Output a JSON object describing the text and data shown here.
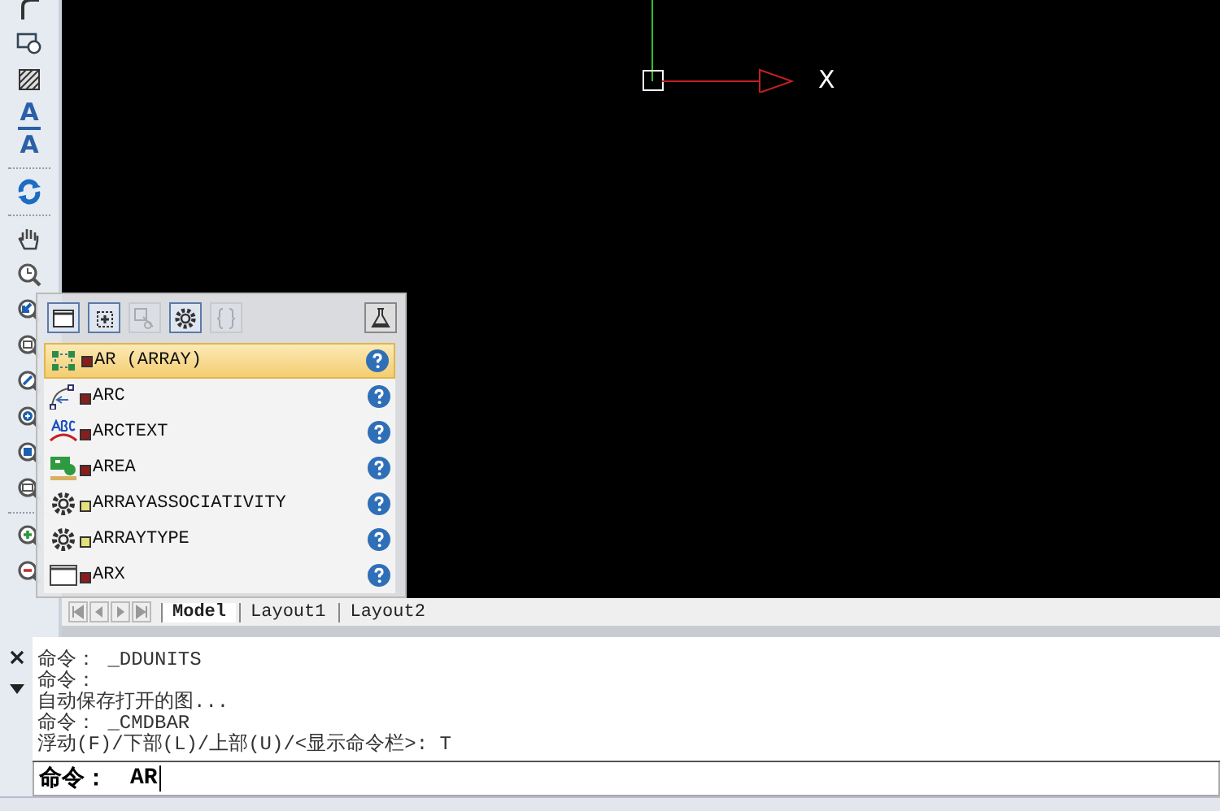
{
  "toolbar": {
    "glyph_tools": [
      {
        "glyph": "A",
        "underlined": true
      },
      {
        "glyph": "A",
        "underlined": false
      }
    ]
  },
  "canvas": {
    "axis_label": "X"
  },
  "layout_tabs": [
    {
      "label": "Model",
      "selected": true
    },
    {
      "label": "Layout1",
      "selected": false
    },
    {
      "label": "Layout2",
      "selected": false
    }
  ],
  "autocomplete": {
    "tool_buttons": [
      {
        "kind": "window",
        "disabled": false
      },
      {
        "kind": "insert",
        "disabled": false
      },
      {
        "kind": "scissors",
        "disabled": true
      },
      {
        "kind": "gear",
        "disabled": false
      },
      {
        "kind": "braces",
        "disabled": true
      },
      {
        "kind": "flask",
        "disabled": false
      }
    ],
    "items": [
      {
        "kind": "array",
        "label": "AR (ARRAY)",
        "color": "#8b1c1c",
        "selected": true
      },
      {
        "kind": "arc",
        "label": "ARC",
        "color": "#8b1c1c",
        "selected": false
      },
      {
        "kind": "arctext",
        "label": "ARCTEXT",
        "color": "#8b1c1c",
        "selected": false
      },
      {
        "kind": "area",
        "label": "AREA",
        "color": "#8b1c1c",
        "selected": false
      },
      {
        "kind": "gear",
        "label": "ARRAYASSOCIATIVITY",
        "color": "#e6e07a",
        "selected": false
      },
      {
        "kind": "gear",
        "label": "ARRAYTYPE",
        "color": "#e6e07a",
        "selected": false
      },
      {
        "kind": "window",
        "label": "ARX",
        "color": "#8b1c1c",
        "selected": false
      }
    ]
  },
  "command": {
    "history": [
      "命令：  _DDUNITS",
      "命令：",
      "自动保存打开的图...",
      "命令：  _CMDBAR",
      "浮动(F)/下部(L)/上部(U)/<显示命令栏>: T"
    ],
    "prompt": "命令：",
    "value": "AR"
  }
}
